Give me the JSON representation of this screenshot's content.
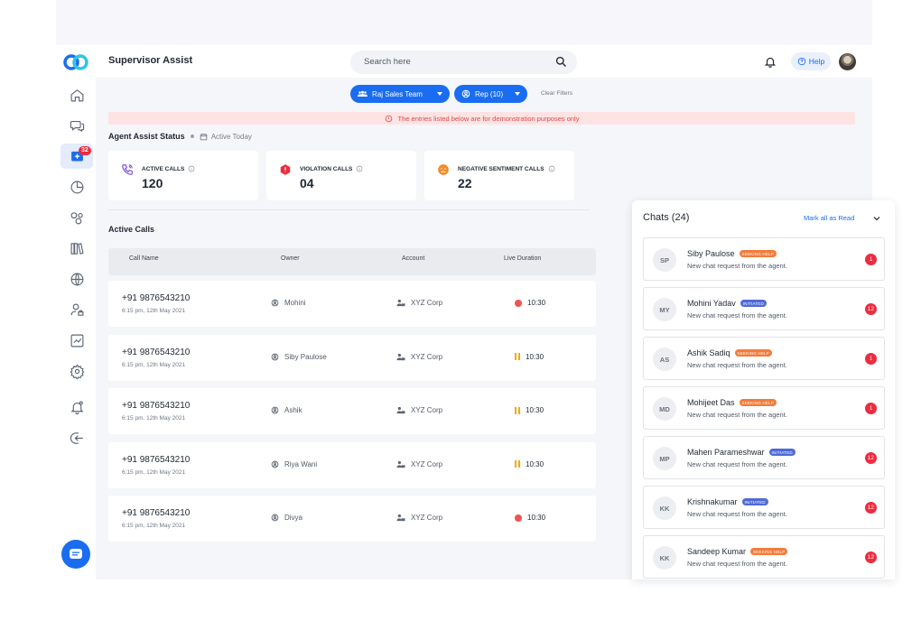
{
  "header": {
    "title": "Supervisor Assist",
    "search_placeholder": "Search here",
    "help_label": "Help"
  },
  "sidebar": {
    "items": [
      {
        "name": "home-icon"
      },
      {
        "name": "chat-bubbles-icon"
      },
      {
        "name": "agent-assist-icon",
        "badge": "32"
      },
      {
        "name": "pie-chart-icon"
      },
      {
        "name": "bubbles-icon"
      },
      {
        "name": "library-icon"
      },
      {
        "name": "globe-icon"
      },
      {
        "name": "users-icon"
      },
      {
        "name": "trend-icon"
      },
      {
        "name": "gear-icon"
      },
      {
        "name": "bell-person-icon"
      },
      {
        "name": "logout-icon"
      }
    ]
  },
  "filters": {
    "team": "Raj Sales Team",
    "rep": "Rep (10)",
    "clear": "Clear Filters"
  },
  "banner": "The entries listed below are for demonstration purposes only",
  "status": {
    "title": "Agent Assist Status",
    "subtitle": "Active Today",
    "cards": [
      {
        "label": "ACTIVE CALLS",
        "value": "120",
        "icon": "phone-icon",
        "color": "#7b4fd6"
      },
      {
        "label": "VIOLATION CALLS",
        "value": "04",
        "icon": "alert-icon",
        "color": "#ef2b3e"
      },
      {
        "label": "NEGATIVE SENTIMENT CALLS",
        "value": "22",
        "icon": "sad-face-icon",
        "color": "#f28c28"
      }
    ]
  },
  "active_calls": {
    "title": "Active Calls",
    "columns": [
      "Call Name",
      "Owner",
      "Account",
      "Live Duration"
    ],
    "rows": [
      {
        "phone": "+91 9876543210",
        "time": "6:15 pm, 12th May 2021",
        "owner": "Mohini",
        "account": "XYZ Corp",
        "duration": "10:30",
        "state": "recording"
      },
      {
        "phone": "+91 9876543210",
        "time": "6:15 pm, 12th May 2021",
        "owner": "Siby Paulose",
        "account": "XYZ Corp",
        "duration": "10:30",
        "state": "paused"
      },
      {
        "phone": "+91 9876543210",
        "time": "6:15 pm, 12th May 2021",
        "owner": "Ashik",
        "account": "XYZ Corp",
        "duration": "10:30",
        "state": "paused"
      },
      {
        "phone": "+91 9876543210",
        "time": "6:15 pm, 12th May 2021",
        "owner": "Riya Wani",
        "account": "XYZ Corp",
        "duration": "10:30",
        "state": "paused"
      },
      {
        "phone": "+91 9876543210",
        "time": "6:15 pm, 12th May 2021",
        "owner": "Divya",
        "account": "XYZ Corp",
        "duration": "10:30",
        "state": "recording"
      }
    ]
  },
  "chats": {
    "title": "Chats (24)",
    "mark_all": "Mark all as Read",
    "items": [
      {
        "initials": "SP",
        "name": "Siby Paulose",
        "tag": "SEEKING HELP",
        "message": "New chat request from the agent.",
        "count": "1"
      },
      {
        "initials": "MY",
        "name": "Mohini Yadav",
        "tag": "INITIATED",
        "message": "New chat request from the agent.",
        "count": "12"
      },
      {
        "initials": "AS",
        "name": "Ashik Sadiq",
        "tag": "SEEKING HELP",
        "message": "New chat request from the agent.",
        "count": "1"
      },
      {
        "initials": "MD",
        "name": "Mohijeet Das",
        "tag": "SEEKING HELP",
        "message": "New chat request from the agent.",
        "count": "1"
      },
      {
        "initials": "MP",
        "name": "Mahen Parameshwar",
        "tag": "INITIATED",
        "message": "New chat request from the agent.",
        "count": "12"
      },
      {
        "initials": "KK",
        "name": "Krishnakumar",
        "tag": "INITIATED",
        "message": "New chat request from the agent.",
        "count": "12"
      },
      {
        "initials": "KK",
        "name": "Sandeep Kumar",
        "tag": "SEEKING HELP",
        "message": "New chat request from the agent.",
        "count": "12"
      }
    ]
  },
  "colors": {
    "accent": "#1a6df0",
    "seeking_help": "#f47b3b",
    "initiated": "#4f6bd8",
    "badge": "#ef2b3e"
  }
}
